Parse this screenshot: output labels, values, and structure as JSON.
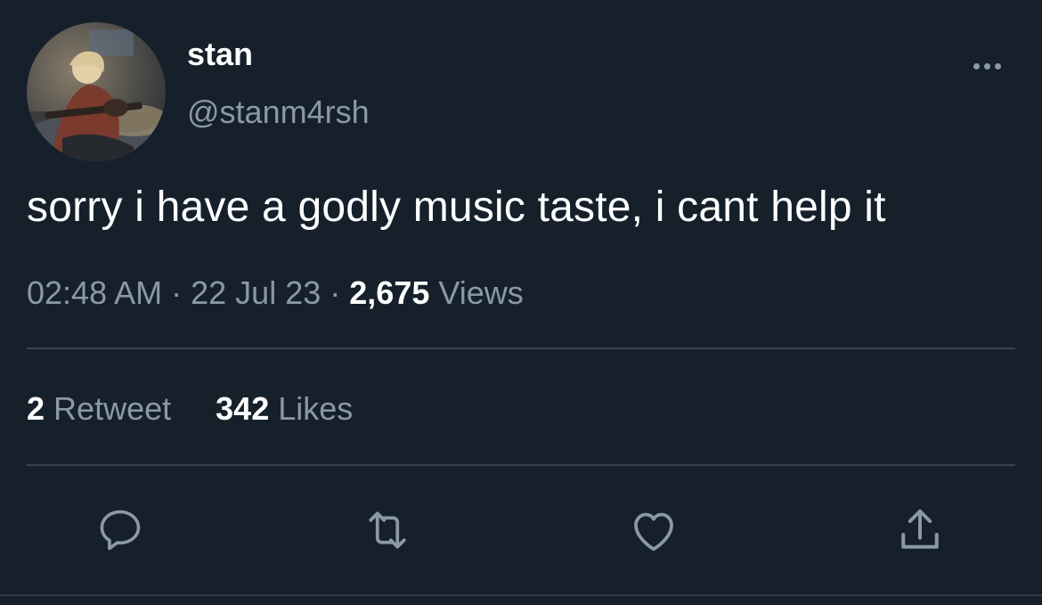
{
  "user": {
    "display_name": "stan",
    "handle": "@stanm4rsh"
  },
  "tweet": {
    "text": "sorry i have a godly music taste, i cant help it",
    "time": "02:48 AM",
    "separator": "·",
    "date": "22 Jul 23",
    "views_count": "2,675",
    "views_label": "Views"
  },
  "stats": {
    "retweets_count": "2",
    "retweets_label": "Retweet",
    "likes_count": "342",
    "likes_label": "Likes"
  },
  "icons": {
    "more": "more-horizontal-icon",
    "reply": "reply-icon",
    "retweet": "retweet-icon",
    "like": "heart-icon",
    "share": "share-icon"
  },
  "colors": {
    "background": "#15202b",
    "text": "#ffffff",
    "secondary_text": "#8b98a5",
    "divider": "#38444d"
  }
}
